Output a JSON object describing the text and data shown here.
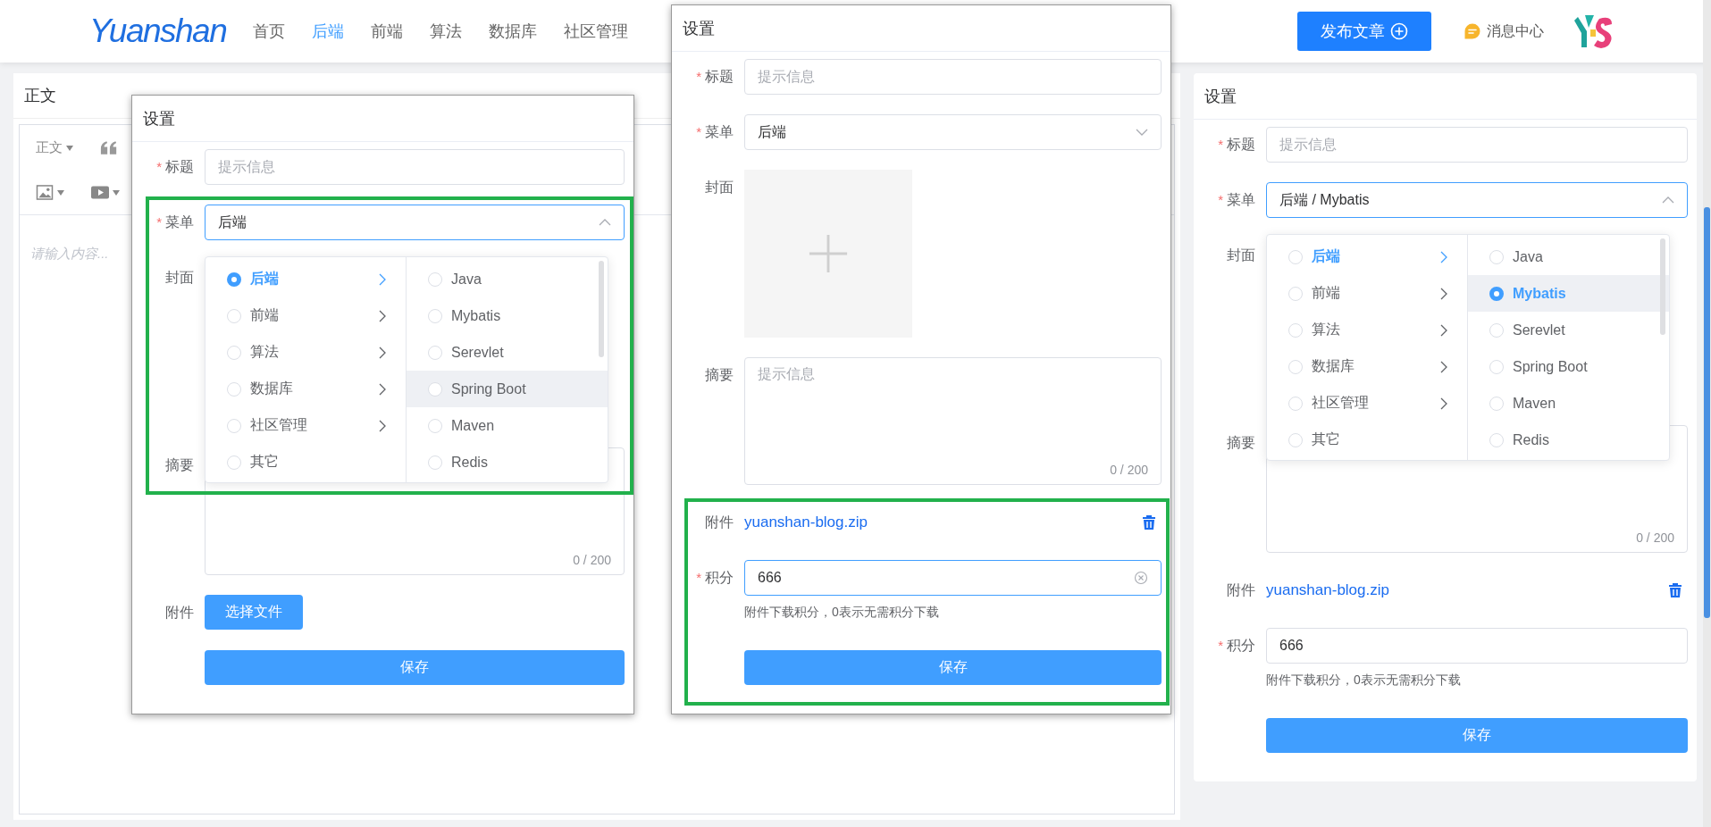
{
  "header": {
    "logo": "Yuanshan",
    "nav": [
      {
        "label": "首页",
        "selected": false
      },
      {
        "label": "后端",
        "selected": true
      },
      {
        "label": "前端",
        "selected": false
      },
      {
        "label": "算法",
        "selected": false
      },
      {
        "label": "数据库",
        "selected": false
      },
      {
        "label": "社区管理",
        "selected": false
      }
    ],
    "publish_button": "发布文章",
    "messages": "消息中心"
  },
  "editor": {
    "title": "正文",
    "toolbar": [
      {
        "items": [
          {
            "kind": "format",
            "label": "正文",
            "has_menu": true
          },
          {
            "kind": "quote",
            "has_menu": false
          }
        ]
      },
      {
        "items": [
          {
            "kind": "image",
            "has_menu": true
          },
          {
            "kind": "video",
            "has_menu": true
          }
        ]
      }
    ],
    "placeholder": "请输入内容..."
  },
  "panels": [
    {
      "kind": "dialog",
      "title": "设置",
      "fields": [
        {
          "kind": "text",
          "label": "标题",
          "required_mark": "*",
          "placeholder": "提示信息"
        },
        {
          "kind": "select",
          "label": "菜单",
          "required_mark": "*",
          "value": "后端",
          "expanded": true,
          "menu": [
            {
              "options": [
                {
                  "label": "后端",
                  "selected": true,
                  "active": true,
                  "highlighted": false,
                  "has_children": true
                },
                {
                  "label": "前端",
                  "selected": false,
                  "active": false,
                  "highlighted": false,
                  "has_children": true
                },
                {
                  "label": "算法",
                  "selected": false,
                  "active": false,
                  "highlighted": false,
                  "has_children": true
                },
                {
                  "label": "数据库",
                  "selected": false,
                  "active": false,
                  "highlighted": false,
                  "has_children": true
                },
                {
                  "label": "社区管理",
                  "selected": false,
                  "active": false,
                  "highlighted": false,
                  "has_children": true
                },
                {
                  "label": "其它",
                  "selected": false,
                  "active": false,
                  "highlighted": false,
                  "has_children": false
                }
              ]
            },
            {
              "options": [
                {
                  "label": "Java",
                  "selected": false,
                  "active": false,
                  "highlighted": false,
                  "has_children": false
                },
                {
                  "label": "Mybatis",
                  "selected": false,
                  "active": false,
                  "highlighted": false,
                  "has_children": false
                },
                {
                  "label": "Serevlet",
                  "selected": false,
                  "active": false,
                  "highlighted": false,
                  "has_children": false
                },
                {
                  "label": "Spring Boot",
                  "selected": false,
                  "active": false,
                  "highlighted": true,
                  "has_children": false
                },
                {
                  "label": "Maven",
                  "selected": false,
                  "active": false,
                  "highlighted": false,
                  "has_children": false
                },
                {
                  "label": "Redis",
                  "selected": false,
                  "active": false,
                  "highlighted": false,
                  "has_children": false
                }
              ]
            }
          ]
        },
        {
          "kind": "cover",
          "label": "封面"
        },
        {
          "kind": "textarea",
          "label": "摘要",
          "counter": "0 / 200"
        },
        {
          "kind": "upload",
          "label": "附件",
          "button": "选择文件"
        },
        {
          "kind": "save",
          "button": "保存"
        }
      ]
    },
    {
      "kind": "dialog",
      "title": "设置",
      "fields": [
        {
          "kind": "text",
          "label": "标题",
          "required_mark": "*",
          "placeholder": "提示信息"
        },
        {
          "kind": "select",
          "label": "菜单",
          "required_mark": "*",
          "value": "后端",
          "expanded": false
        },
        {
          "kind": "cover",
          "label": "封面",
          "upload_box": true
        },
        {
          "kind": "textarea",
          "label": "摘要",
          "placeholder": "提示信息",
          "counter": "0 / 200"
        },
        {
          "kind": "file",
          "label": "附件",
          "file": "yuanshan-blog.zip"
        },
        {
          "kind": "number",
          "label": "积分",
          "required_mark": "*",
          "value": "666",
          "focused": true,
          "hint": "附件下载积分，0表示无需积分下载"
        },
        {
          "kind": "save",
          "button": "保存"
        }
      ]
    },
    {
      "kind": "card",
      "title": "设置",
      "fields": [
        {
          "kind": "text",
          "label": "标题",
          "required_mark": "*",
          "placeholder": "提示信息"
        },
        {
          "kind": "select",
          "label": "菜单",
          "required_mark": "*",
          "value": "后端 / Mybatis",
          "expanded": true,
          "menu": [
            {
              "options": [
                {
                  "label": "后端",
                  "selected": false,
                  "active": true,
                  "highlighted": false,
                  "has_children": true
                },
                {
                  "label": "前端",
                  "selected": false,
                  "active": false,
                  "highlighted": false,
                  "has_children": true
                },
                {
                  "label": "算法",
                  "selected": false,
                  "active": false,
                  "highlighted": false,
                  "has_children": true
                },
                {
                  "label": "数据库",
                  "selected": false,
                  "active": false,
                  "highlighted": false,
                  "has_children": true
                },
                {
                  "label": "社区管理",
                  "selected": false,
                  "active": false,
                  "highlighted": false,
                  "has_children": true
                },
                {
                  "label": "其它",
                  "selected": false,
                  "active": false,
                  "highlighted": false,
                  "has_children": false
                }
              ]
            },
            {
              "options": [
                {
                  "label": "Java",
                  "selected": false,
                  "active": false,
                  "highlighted": false,
                  "has_children": false
                },
                {
                  "label": "Mybatis",
                  "selected": true,
                  "active": true,
                  "highlighted": true,
                  "has_children": false
                },
                {
                  "label": "Serevlet",
                  "selected": false,
                  "active": false,
                  "highlighted": false,
                  "has_children": false
                },
                {
                  "label": "Spring Boot",
                  "selected": false,
                  "active": false,
                  "highlighted": false,
                  "has_children": false
                },
                {
                  "label": "Maven",
                  "selected": false,
                  "active": false,
                  "highlighted": false,
                  "has_children": false
                },
                {
                  "label": "Redis",
                  "selected": false,
                  "active": false,
                  "highlighted": false,
                  "has_children": false
                }
              ]
            }
          ]
        },
        {
          "kind": "cover",
          "label": "封面"
        },
        {
          "kind": "textarea",
          "label": "摘要",
          "counter": "0 / 200"
        },
        {
          "kind": "file",
          "label": "附件",
          "file": "yuanshan-blog.zip"
        },
        {
          "kind": "number",
          "label": "积分",
          "required_mark": "*",
          "value": "666",
          "focused": false,
          "hint": "附件下载积分，0表示无需积分下载"
        },
        {
          "kind": "save",
          "button": "保存"
        }
      ]
    }
  ]
}
